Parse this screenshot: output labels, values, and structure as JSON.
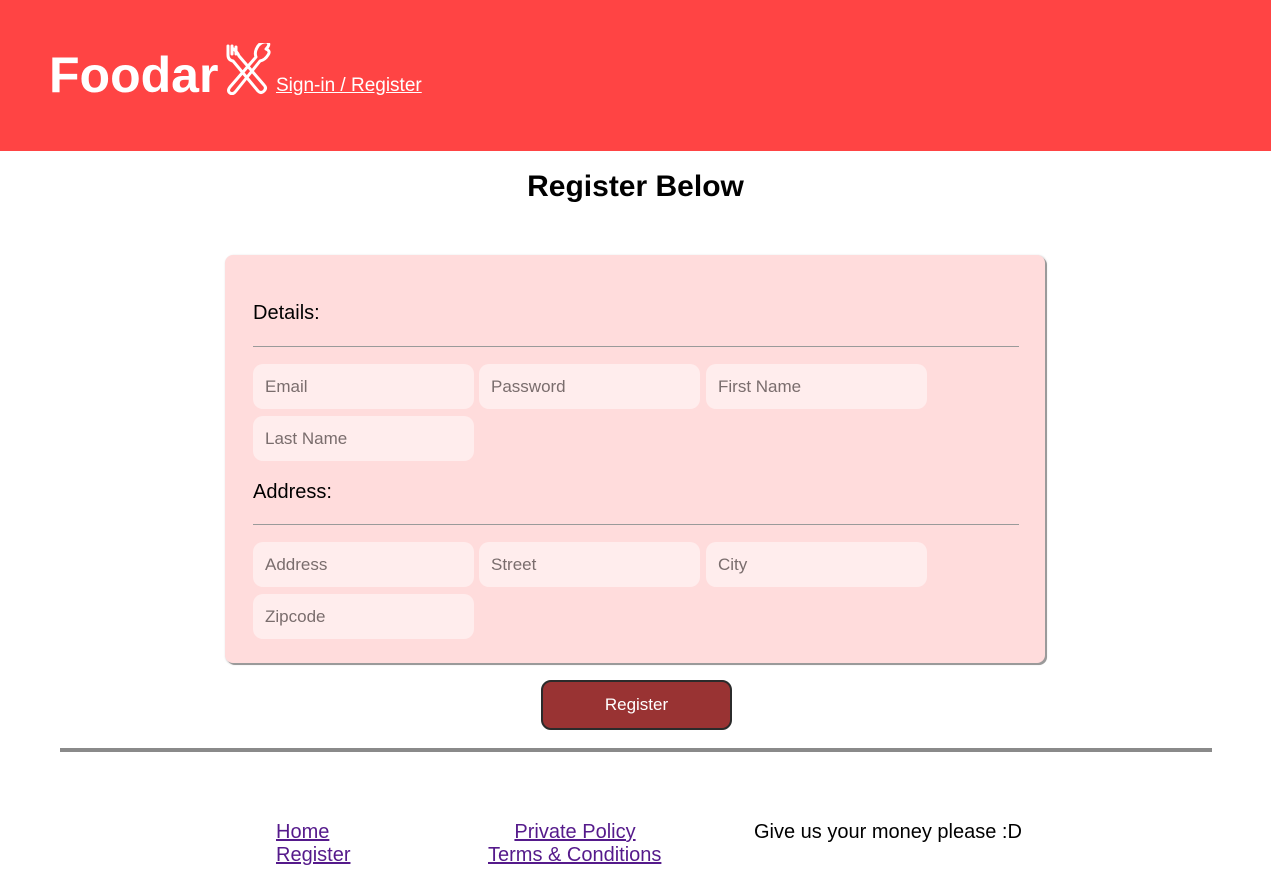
{
  "header": {
    "brand": "Foodar",
    "logo_icon": "fork-and-spoon-icon",
    "nav_link": "Sign-in / Register",
    "background_color": "#ff4444"
  },
  "main": {
    "title": "Register Below"
  },
  "form": {
    "details_label": "Details:",
    "address_label": "Address:",
    "fields": {
      "email": {
        "placeholder": "Email",
        "value": ""
      },
      "password": {
        "placeholder": "Password",
        "value": ""
      },
      "first_name": {
        "placeholder": "First Name",
        "value": ""
      },
      "last_name": {
        "placeholder": "Last Name",
        "value": ""
      },
      "address": {
        "placeholder": "Address",
        "value": ""
      },
      "street": {
        "placeholder": "Street",
        "value": ""
      },
      "city": {
        "placeholder": "City",
        "value": ""
      },
      "zipcode": {
        "placeholder": "Zipcode",
        "value": ""
      }
    },
    "register_label": "Register",
    "register_color": "#993333"
  },
  "footer": {
    "links_left": [
      "Home",
      "Register"
    ],
    "links_center": [
      "Private Policy",
      "Terms & Conditions"
    ],
    "message": "Give us your money please :D"
  }
}
